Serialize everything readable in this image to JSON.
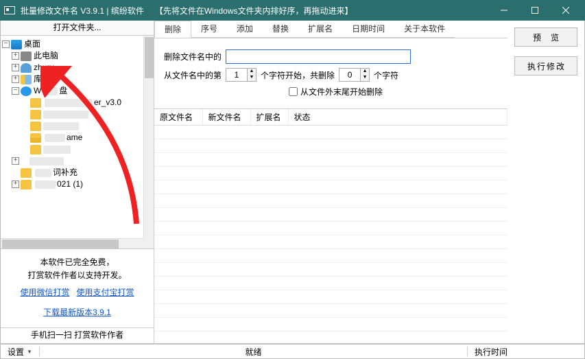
{
  "titlebar": {
    "title": "批量修改文件名 V3.9.1 | 缤纷软件",
    "hint": "【先将文件在Windows文件夹内排好序，再拖动进来】"
  },
  "left": {
    "header": "打开文件夹...",
    "tree": {
      "root": "桌面",
      "items": [
        {
          "label": "此电脑"
        },
        {
          "label": "zhuru"
        },
        {
          "label": "库"
        },
        {
          "label_prefix": "W",
          "label_suffix": "盘"
        },
        {
          "label_suffix": "er_v3.0",
          "indent": 2
        },
        {
          "indent": 2,
          "blur": true
        },
        {
          "indent": 2,
          "blur": true
        },
        {
          "label_suffix": "ame",
          "indent": 2
        },
        {
          "indent": 2,
          "blur": true
        },
        {
          "indent": 1,
          "blur": true
        },
        {
          "label_suffix": "词补充",
          "indent": 1
        },
        {
          "label_suffix": "021 (1)",
          "indent": 1
        }
      ]
    },
    "promo": {
      "line1": "本软件已完全免费，",
      "line2": "打赏软件作者以支持开发。",
      "wechat": "使用微信打赏",
      "alipay": "使用支付宝打赏",
      "download": "下载最新版本3.9.1"
    },
    "footer": "手机扫一扫 打赏软件作者"
  },
  "tabs": [
    "删除",
    "序号",
    "添加",
    "替换",
    "扩展名",
    "日期时间",
    "关于本软件"
  ],
  "active_tab": 0,
  "panel": {
    "row1_label": "删除文件名中的",
    "row1_value": "",
    "row2_prefix": "从文件名中的第",
    "row2_spin1": "1",
    "row2_mid": "个字符开始，共删除",
    "row2_spin2": "0",
    "row2_suffix": "个字符",
    "checkbox_label": "从文件外末尾开始删除"
  },
  "grid": {
    "headers": [
      "原文件名",
      "新文件名",
      "扩展名",
      "状态"
    ]
  },
  "buttons": {
    "preview": "预览",
    "apply": "执行修改"
  },
  "statusbar": {
    "settings": "设置",
    "ready": "就绪",
    "exec_time": "执行时间"
  }
}
